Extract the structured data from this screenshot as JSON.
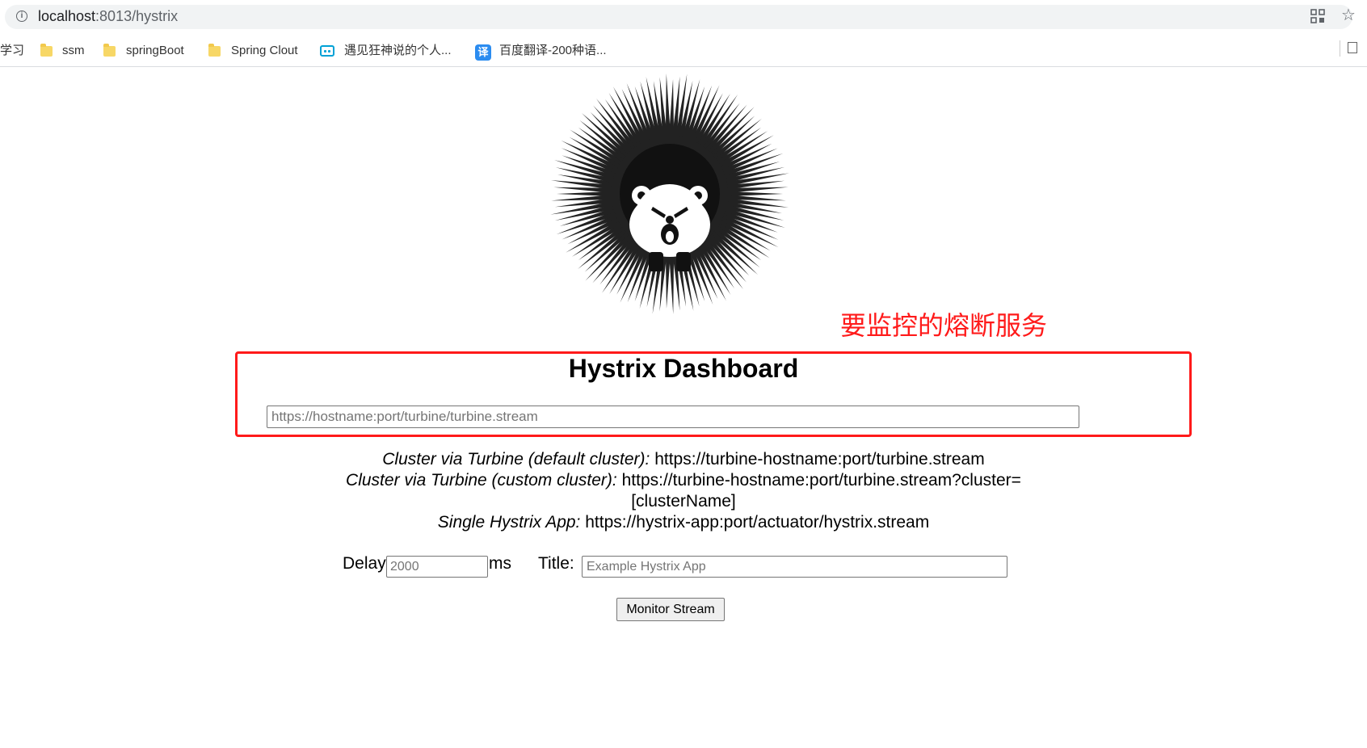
{
  "browser": {
    "url_host": "localhost",
    "url_rest": ":8013/hystrix",
    "bookmarks": [
      {
        "label": "学习"
      },
      {
        "label": "ssm"
      },
      {
        "label": "springBoot"
      },
      {
        "label": "Spring Clout"
      },
      {
        "label": "遇见狂神说的个人..."
      },
      {
        "label": "百度翻译-200种语..."
      }
    ],
    "translate_glyph": "译"
  },
  "annotation": {
    "text": "要监控的熔断服务",
    "color": "#ff1a1a"
  },
  "dashboard": {
    "title": "Hystrix Dashboard",
    "stream_placeholder": "https://hostname:port/turbine/turbine.stream",
    "help": [
      {
        "label": "Cluster via Turbine (default cluster):",
        "value": "https://turbine-hostname:port/turbine.stream"
      },
      {
        "label": "Cluster via Turbine (custom cluster):",
        "value": "https://turbine-hostname:port/turbine.stream?cluster="
      },
      {
        "label": "",
        "value": "[clusterName]"
      },
      {
        "label": "Single Hystrix App:",
        "value": "https://hystrix-app:port/actuator/hystrix.stream"
      }
    ],
    "delay_label": "Delay:",
    "delay_placeholder": "2000",
    "delay_unit": "ms",
    "title_label": "Title:",
    "title_placeholder": "Example Hystrix App",
    "monitor_button": "Monitor Stream"
  }
}
